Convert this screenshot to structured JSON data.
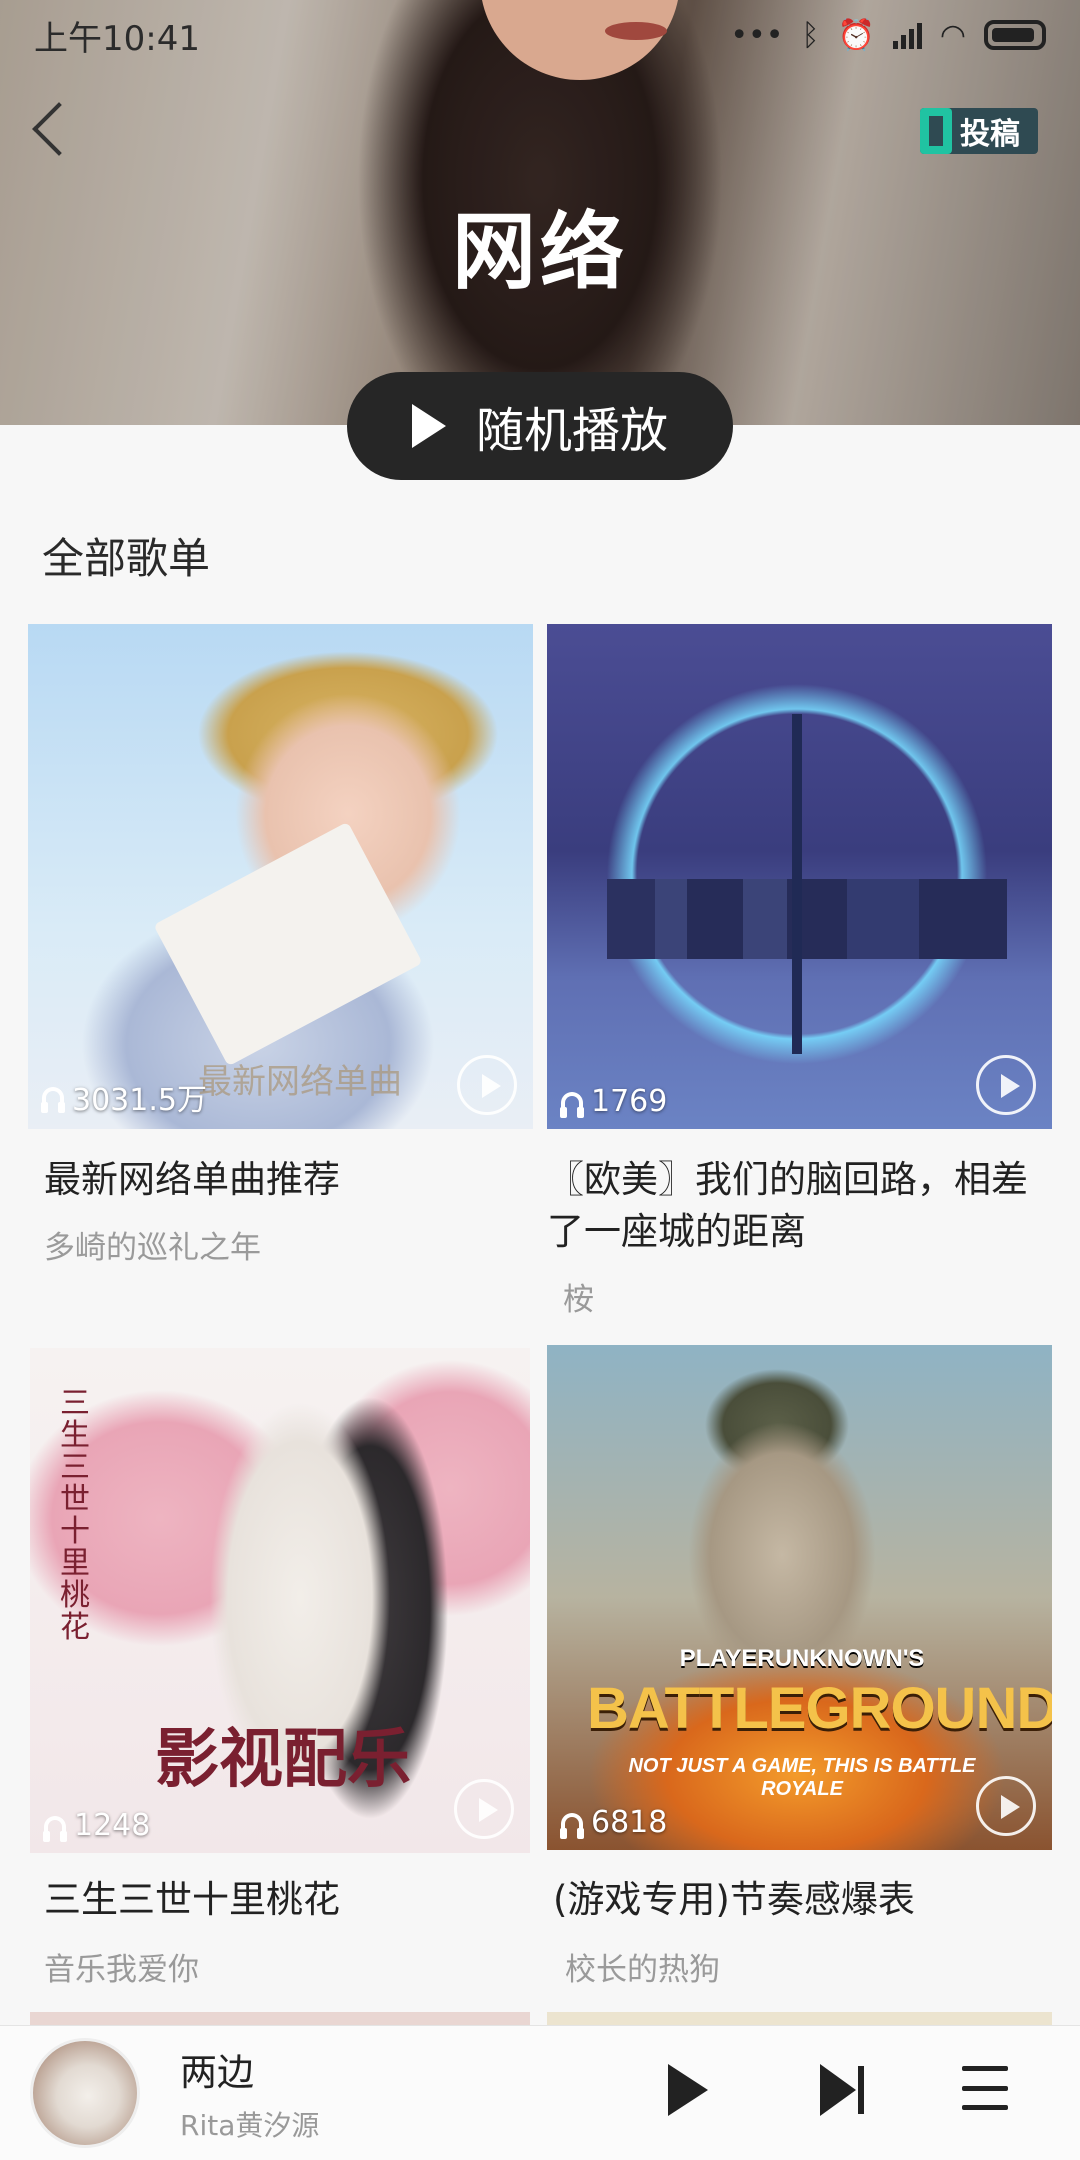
{
  "status_bar": {
    "time": "上午10:41",
    "icons": [
      "more-dots-icon",
      "bluetooth-icon",
      "alarm-icon",
      "signal-icon",
      "wifi-icon",
      "battery-icon"
    ]
  },
  "header": {
    "back_icon": "back-chevron-icon",
    "submit_label": "投稿",
    "title": "网络",
    "shuffle_label": "随机播放"
  },
  "section": {
    "title": "全部歌单"
  },
  "playlists": [
    {
      "title": "最新网络单曲推荐",
      "creator": "多崎的巡礼之年",
      "plays": "3031.5万",
      "cover_text": "最新网络单曲"
    },
    {
      "title": "〖欧美〗我们的脑回路，相差了一座城的距离",
      "creator": "桉",
      "plays": "1769"
    },
    {
      "title": "三生三世十里桃花",
      "creator": "音乐我爱你",
      "plays": "1248",
      "cover_text": "影视配乐",
      "cover_side": "三生三世十里桃花"
    },
    {
      "title": "(游戏专用)节奏感爆表",
      "creator": "校长的热狗",
      "plays": "6818",
      "cover_text_top": "PLAYERUNKNOWN'S",
      "cover_text_main": "BATTLEGROUNDS",
      "cover_text_sub": "NOT JUST A GAME, THIS IS BATTLE ROYALE"
    }
  ],
  "player": {
    "song": "两边",
    "artist": "Rita黄汐源",
    "controls": [
      "play-icon",
      "next-icon",
      "playlist-menu-icon"
    ]
  }
}
